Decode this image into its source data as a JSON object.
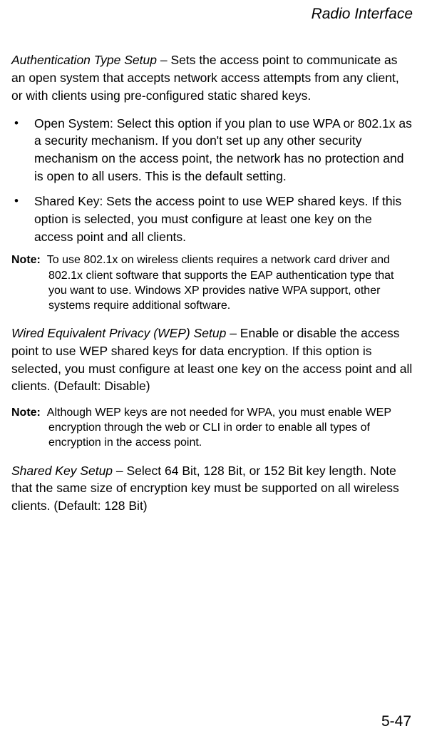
{
  "header": {
    "title": "Radio Interface"
  },
  "sections": {
    "auth": {
      "lead": "Authentication Type Setup",
      "text": " – Sets the access point to communicate as an open system that accepts network access attempts from any client, or with clients using pre-configured static shared keys."
    },
    "bullets": [
      "Open System: Select this option if you plan to use WPA or 802.1x as a security mechanism. If you don't set up any other security mechanism on the access point, the network has no protection and is open to all users. This is the default setting.",
      "Shared Key: Sets the access point to use WEP shared keys. If this option is selected, you must configure at least one key on the access point and all clients."
    ],
    "note1": {
      "label": "Note:",
      "text": "To use 802.1x on wireless clients requires a network card driver and 802.1x client software that supports the EAP authentication type that you want to use. Windows XP provides native WPA support, other systems require additional software."
    },
    "wep": {
      "lead": "Wired Equivalent Privacy (WEP) Setup",
      "text": " – Enable or disable the access point to use WEP shared keys for data encryption. If this option is selected, you must configure at least one key on the access point and all clients. (Default: Disable)"
    },
    "note2": {
      "label": "Note:",
      "text": "Although WEP keys are not needed for WPA, you must enable WEP encryption through the web or CLI in order to enable all types of encryption in the access point."
    },
    "sharedkey": {
      "lead": "Shared Key Setup",
      "text": " – Select 64 Bit, 128 Bit, or 152 Bit key length. Note that the same size of encryption key must be supported on all wireless clients. (Default: 128 Bit)"
    }
  },
  "footer": {
    "page": "5-47"
  }
}
